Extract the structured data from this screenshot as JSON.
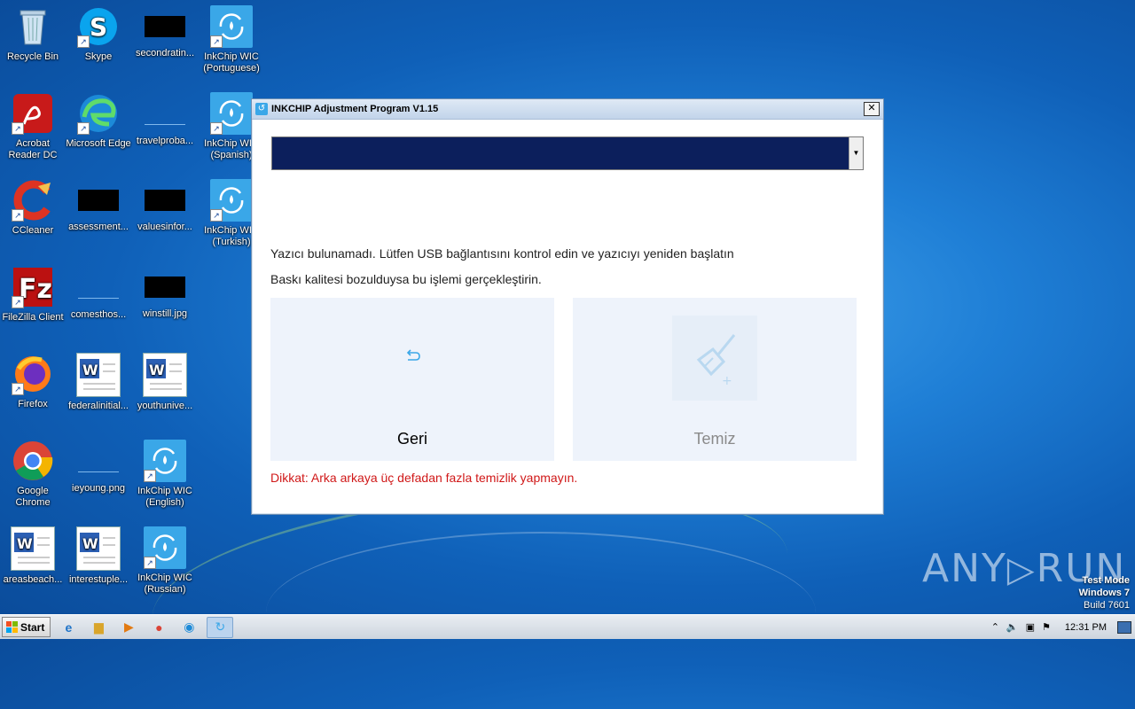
{
  "desktop": {
    "icons": [
      {
        "label": "Recycle Bin"
      },
      {
        "label": "Skype"
      },
      {
        "label": "secondratin..."
      },
      {
        "label": "InkChip WIC (Portuguese)"
      },
      {
        "label": "Acrobat Reader DC"
      },
      {
        "label": "Microsoft Edge"
      },
      {
        "label": "travelproba..."
      },
      {
        "label": "InkChip WIC (Spanish)"
      },
      {
        "label": "CCleaner"
      },
      {
        "label": "assessment..."
      },
      {
        "label": "valuesinfor..."
      },
      {
        "label": "InkChip WIC (Turkish)"
      },
      {
        "label": "FileZilla Client"
      },
      {
        "label": "comesthos..."
      },
      {
        "label": "winstill.jpg"
      },
      {
        "label": "Firefox"
      },
      {
        "label": "federalinitial..."
      },
      {
        "label": "youthunive..."
      },
      {
        "label": "Google Chrome"
      },
      {
        "label": "ieyoung.png"
      },
      {
        "label": "InkChip WIC (English)"
      },
      {
        "label": "areasbeach..."
      },
      {
        "label": "interestuple..."
      },
      {
        "label": "InkChip WIC (Russian)"
      }
    ]
  },
  "dialog": {
    "title": "INKCHIP Adjustment Program V1.15",
    "close_symbol": "✕",
    "select_value": "",
    "message1": "Yazıcı bulunamadı. Lütfen USB bağlantısını kontrol edin ve yazıcıyı yeniden başlatın",
    "message2": "Baskı kalitesi bozulduysa bu işlemi gerçekleştirin.",
    "back_label": "Geri",
    "clean_label": "Temiz",
    "warning": "Dikkat: Arka arkaya üç defadan fazla temizlik yapmayın.",
    "back_color": "#000000",
    "clean_color": "#8a8a8a",
    "warning_color": "#d01818"
  },
  "watermark": {
    "brand_left": "ANY",
    "brand_right": "RUN",
    "line1": "Test Mode",
    "line2": "Windows 7",
    "line3": "Build 7601"
  },
  "taskbar": {
    "start_label": "Start",
    "clock": "12:31 PM"
  }
}
